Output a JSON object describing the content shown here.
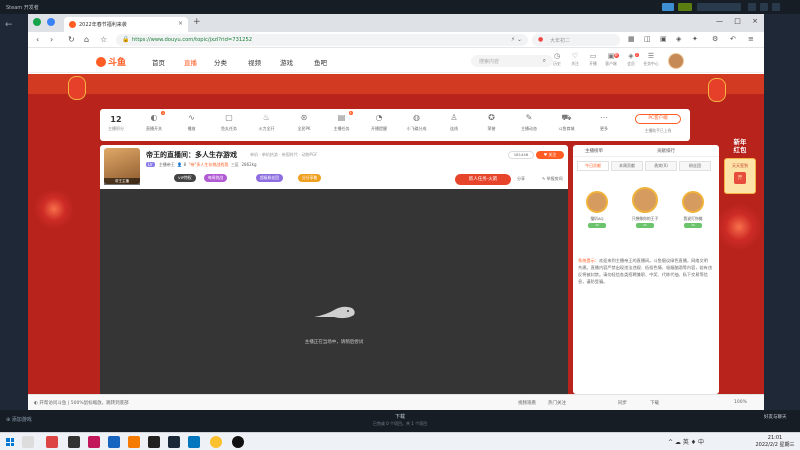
{
  "steam": {
    "title": "Steam 开发者",
    "add_game": "添加游戏",
    "download": "下载",
    "download_sub": "已完成 0 个项目，共 1 个项目",
    "friends": "好友与聊天"
  },
  "browser": {
    "tab_title": "2022年春节福利来袭",
    "url": "https://www.douyu.com/topic/jxzl?rid=731252",
    "search_placeholder": "大年初二"
  },
  "site": {
    "logo": "斗鱼",
    "nav": [
      "首页",
      "直播",
      "分类",
      "视频",
      "游戏",
      "鱼吧"
    ],
    "search_placeholder": "搜索内容",
    "header_icons": [
      {
        "label": "历史",
        "icon": "history-icon",
        "glyph": "◷"
      },
      {
        "label": "关注",
        "icon": "heart-icon",
        "glyph": "♡"
      },
      {
        "label": "开播",
        "icon": "camera-icon",
        "glyph": "▭"
      },
      {
        "label": "客户端",
        "icon": "client-icon",
        "glyph": "▣",
        "badge": "新"
      },
      {
        "label": "会员",
        "icon": "vip-icon",
        "glyph": "◈",
        "badge": "2"
      },
      {
        "label": "任务中心",
        "icon": "task-icon",
        "glyph": "☰"
      }
    ]
  },
  "strip": {
    "level_value": "12",
    "level_label": "主播积分",
    "items": [
      {
        "label": "直播开关",
        "icon": "toggle-icon",
        "glyph": "◐",
        "badge": "1"
      },
      {
        "label": "播放",
        "icon": "waveform-icon",
        "glyph": "∿"
      },
      {
        "label": "鱼丸任务",
        "icon": "task-card-icon",
        "glyph": "▢"
      },
      {
        "label": "火力全开",
        "icon": "fire-icon",
        "glyph": "♨"
      },
      {
        "label": "全民PK",
        "icon": "pk-icon",
        "glyph": "⊛"
      },
      {
        "label": "主播任务",
        "icon": "clipboard-icon",
        "glyph": "▤",
        "badge": "3"
      },
      {
        "label": "开播提醒",
        "icon": "alarm-icon",
        "glyph": "◔"
      },
      {
        "label": "小飞碟分成",
        "icon": "ufo-icon",
        "glyph": "◍"
      },
      {
        "label": "连线",
        "icon": "people-icon",
        "glyph": "♙"
      },
      {
        "label": "荣誉",
        "icon": "gamepad-icon",
        "glyph": "✪"
      },
      {
        "label": "主播动态",
        "icon": "edit-icon",
        "glyph": "✎"
      },
      {
        "label": "斗鱼商城",
        "icon": "cart-icon",
        "glyph": "⛟"
      },
      {
        "label": "更多",
        "icon": "more-icon",
        "glyph": "⋯"
      }
    ],
    "pc_button": "PC客户端",
    "pc_sub": "主播助手已上线"
  },
  "streamer": {
    "title": "帝王的直播间：多人生存游戏",
    "category": "单机 · 单机热游 · 帝国时代 · 动物PGF",
    "level": "LV",
    "name": "主播帝王",
    "tag": "\"帝\"多人生存挑战找我",
    "hot": "👤 8",
    "viewers": "三区",
    "fans": "2862kg",
    "chips": [
      {
        "label": "VIP特权",
        "color": "#444"
      },
      {
        "label": "每周挑战",
        "color": "#b15ad3"
      },
      {
        "label": "超级粉丝团",
        "color": "#8e6de0"
      },
      {
        "label": "分分享着",
        "color": "#f0a020"
      }
    ],
    "room_no": "181446",
    "follow": "♥ 关注",
    "newbie": "新人任务·火箭",
    "share": "分享",
    "report": "✎ 举报房间",
    "avatar_tag": "帝王主播"
  },
  "player": {
    "message": "主播正在当场中，请稍后尝试"
  },
  "sidebar": {
    "header_tabs": [
      "主播榜单",
      "贡献排行"
    ],
    "sub_tabs": [
      "今日贡献",
      "本周贡献",
      "贵宾(0)",
      "粉丝团"
    ],
    "ranks": [
      {
        "name": "猫叭AQ",
        "level": "12"
      },
      {
        "name": "只想做你的王子",
        "level": "21"
      },
      {
        "name": "我说打你佛",
        "level": "11"
      }
    ],
    "notice_label": "系统提示：",
    "notice_text": "欢迎来到主播帝王的直播间。斗鱼倡议绿色直播，网络文明共建。直播内容严禁出现违法违规、低俗色情、吸烟酗酒等内容，若有违反将被封禁。请勿轻信各类招聘兼职、中奖、代练代抽、私下交易等信息，谨防受骗。"
  },
  "promo": {
    "title_line1": "新年",
    "title_line2": "红包",
    "box_line": "天天签到",
    "box_icon": "开"
  },
  "statusbar": {
    "left": "◐ 开帮访问斗鱼 | 500%鼠标缩放，跳转到底部",
    "video": "视频观看",
    "hotfollow": "热门关注",
    "sync": "同步",
    "download": "下载",
    "zoom": "100%"
  },
  "taskbar": {
    "time": "21:01",
    "date": "2022/2/2 星期三",
    "tray": "^ ☁ 英 ♦ 中"
  }
}
